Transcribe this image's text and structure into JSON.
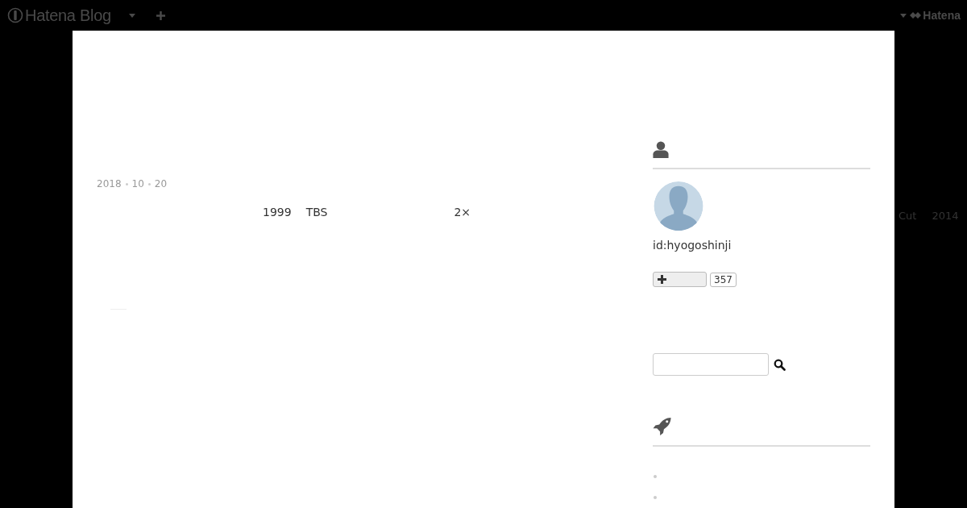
{
  "header": {
    "logo": "Hatena Blog",
    "brand": "Hatena"
  },
  "entry": {
    "date": [
      "2018",
      "10",
      "20"
    ],
    "words": [
      {
        "text": "1999",
        "kind": "word"
      },
      {
        "text": "TBS",
        "kind": "word"
      },
      {
        "text": "2×",
        "kind": "far"
      }
    ]
  },
  "overflow": [
    "Cut",
    "2014"
  ],
  "profile": {
    "id": "id:hyogoshinji",
    "bookmark_count": "357"
  },
  "archive": [
    {
      "kind": "bullet"
    },
    {
      "kind": "bullet"
    }
  ]
}
